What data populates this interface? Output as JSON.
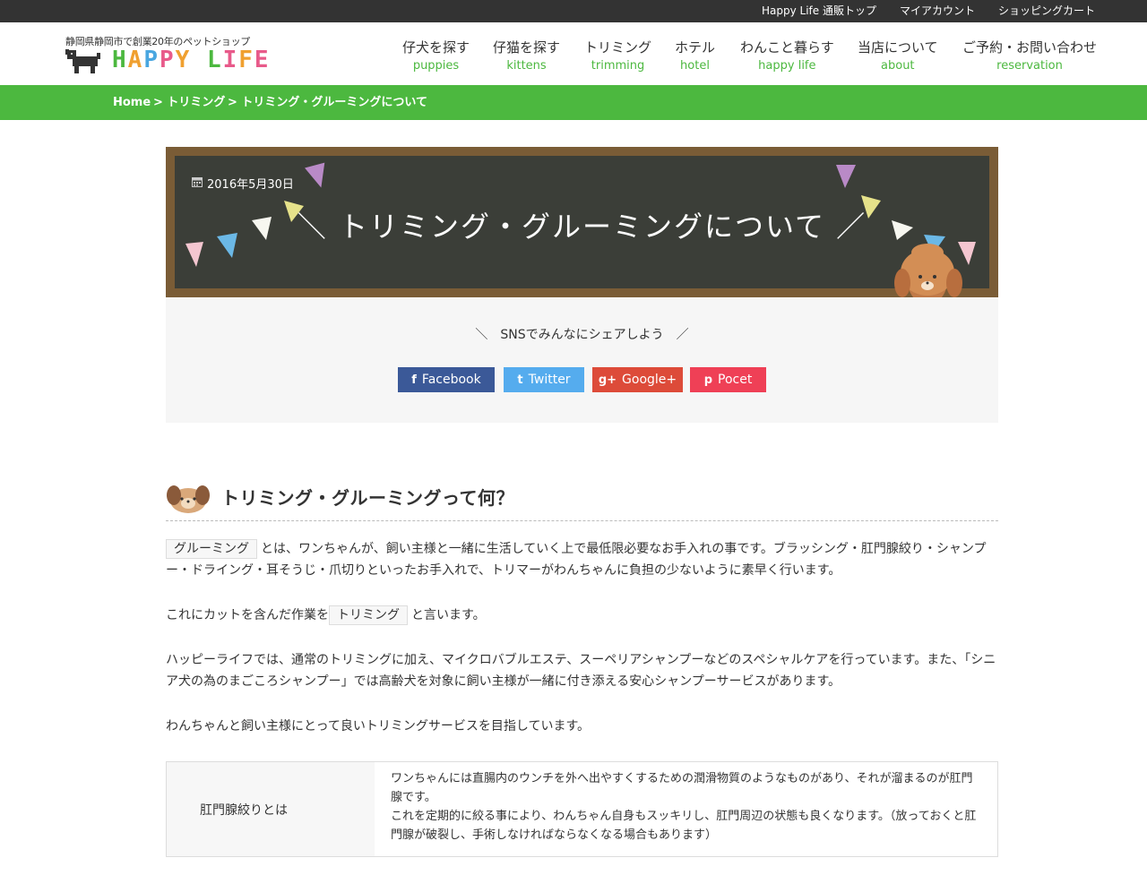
{
  "topbar": {
    "links": [
      "Happy Life 通販トップ",
      "マイアカウント",
      "ショッピングカート"
    ]
  },
  "header": {
    "tagline": "静岡県静岡市で創業20年のペットショップ",
    "logo_letters": [
      "H",
      "A",
      "P",
      "P",
      "Y",
      " ",
      "L",
      "I",
      "F",
      "E"
    ],
    "logo_colors": [
      "#4cb83f",
      "#f0a030",
      "#49a6e0",
      "#e85a8a",
      "#f0a030",
      "",
      "#4cb83f",
      "#e85a8a",
      "#f0a030",
      "#e85a8a"
    ]
  },
  "nav": [
    {
      "jp": "仔犬を探す",
      "en": "puppies"
    },
    {
      "jp": "仔猫を探す",
      "en": "kittens"
    },
    {
      "jp": "トリミング",
      "en": "trimming"
    },
    {
      "jp": "ホテル",
      "en": "hotel"
    },
    {
      "jp": "わんこと暮らす",
      "en": "happy life"
    },
    {
      "jp": "当店について",
      "en": "about"
    },
    {
      "jp": "ご予約・お問い合わせ",
      "en": "reservation"
    }
  ],
  "breadcrumb": [
    "Home",
    "> トリミング",
    "> トリミング・グルーミングについて"
  ],
  "post": {
    "date": "2016年5月30日",
    "title": "＼ トリミング・グルーミングについて ／"
  },
  "sns": {
    "caption": "＼　SNSでみんなにシェアしよう　／",
    "buttons": [
      {
        "icon": "f",
        "label": "Facebook",
        "color": "#3b5998"
      },
      {
        "icon": "t",
        "label": "Twitter",
        "color": "#55acee"
      },
      {
        "icon": "g+",
        "label": "Google+",
        "color": "#dd4b39"
      },
      {
        "icon": "p",
        "label": "Pocet",
        "color": "#ef4056"
      }
    ]
  },
  "section": {
    "title": "トリミング・グルーミングって何？"
  },
  "paragraphs": {
    "p1_keyword": "グルーミング",
    "p1_text": "とは、ワンちゃんが、飼い主様と一緒に生活していく上で最低限必要なお手入れの事です。ブラッシング・肛門腺絞り・シャンプー・ドライング・耳そうじ・爪切りといったお手入れで、トリマーがわんちゃんに負担の少ないように素早く行います。",
    "p2_before": "これにカットを含んだ作業を",
    "p2_keyword": "トリミング",
    "p2_after": "と言います。",
    "p3": "ハッピーライフでは、通常のトリミングに加え、マイクロバブルエステ、スーペリアシャンプーなどのスペシャルケアを行っています。また、「シニア犬の為のまごころシャンプー」では高齢犬を対象に飼い主様が一緒に付き添える安心シャンプーサービスがあります。",
    "p4": "わんちゃんと飼い主様にとって良いトリミングサービスを目指しています。"
  },
  "table": {
    "header": "肛門腺絞りとは",
    "line1": "ワンちゃんには直腸内のウンチを外へ出やすくするための潤滑物質のようなものがあり、それが溜まるのが肛門腺です。",
    "line2": "これを定期的に絞る事により、わんちゃん自身もスッキリし、肛門周辺の状態も良くなります。（放っておくと肛門腺が破裂し、手術しなければならなくなる場合もあります）"
  }
}
